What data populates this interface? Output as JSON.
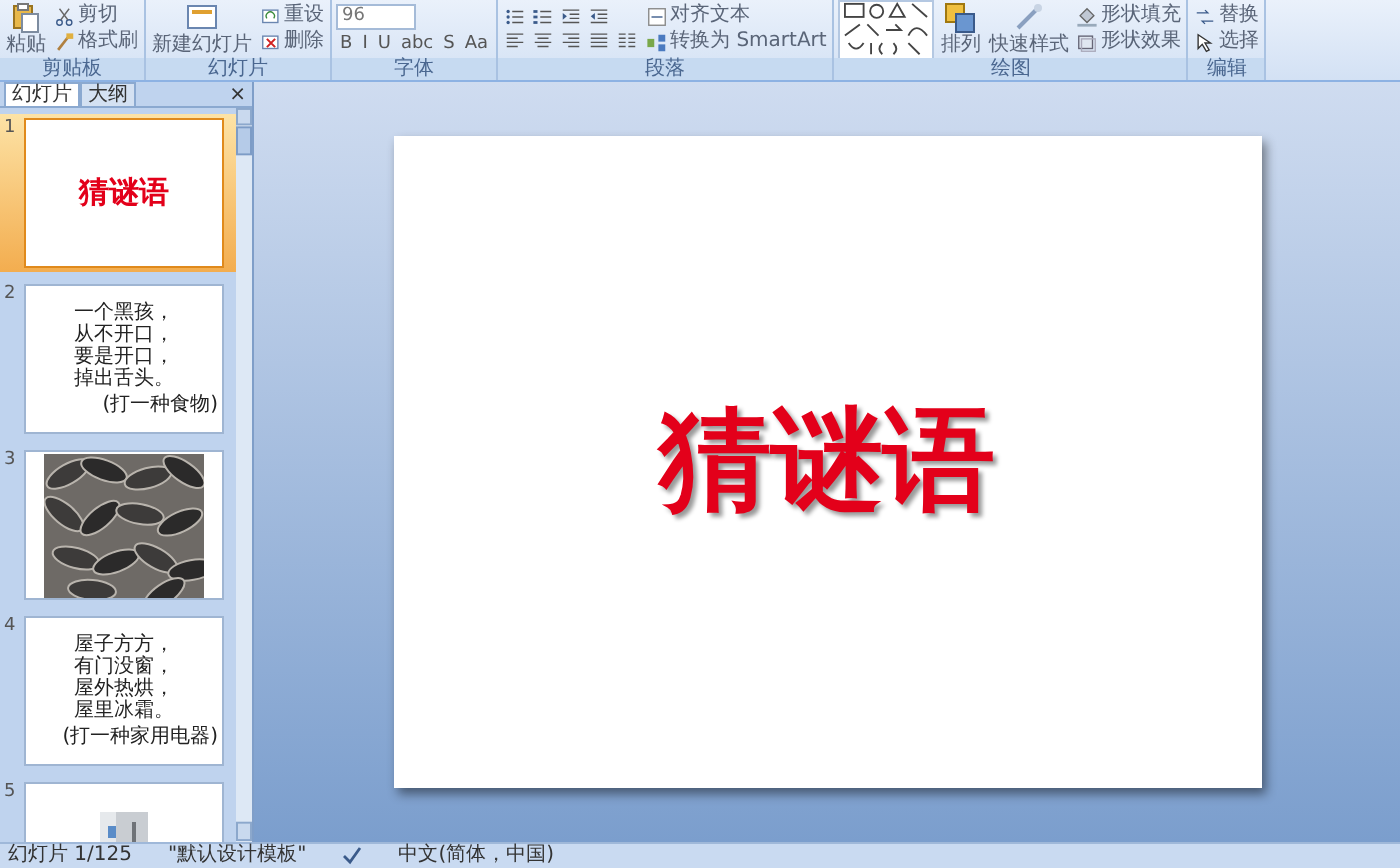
{
  "ribbon": {
    "groups": [
      {
        "label": "剪贴板",
        "columns": [
          [
            {
              "kind": "large",
              "label": "粘贴"
            }
          ],
          [
            {
              "kind": "small",
              "label": "剪切"
            },
            {
              "kind": "small",
              "label": "格式刷"
            }
          ]
        ]
      },
      {
        "label": "幻灯片",
        "columns": [
          [
            {
              "kind": "large",
              "label": "新建幻灯片"
            }
          ],
          [
            {
              "kind": "small",
              "label": "重设"
            },
            {
              "kind": "small",
              "label": "删除"
            }
          ]
        ]
      },
      {
        "label": "字体",
        "columns": [
          [
            {
              "kind": "field",
              "value": "96"
            },
            {
              "kind": "row",
              "items": [
                {
                  "kind": "glyph",
                  "label": "B"
                },
                {
                  "kind": "glyph",
                  "label": "I"
                },
                {
                  "kind": "glyph",
                  "label": "U"
                },
                {
                  "kind": "glyph",
                  "label": "abc"
                },
                {
                  "kind": "glyph",
                  "label": "S"
                },
                {
                  "kind": "glyph",
                  "label": "Aa"
                }
              ]
            }
          ]
        ]
      },
      {
        "label": "段落",
        "columns": [
          [
            {
              "kind": "row",
              "items": [
                {
                  "kind": "icon"
                },
                {
                  "kind": "icon"
                },
                {
                  "kind": "icon"
                },
                {
                  "kind": "icon"
                }
              ]
            },
            {
              "kind": "row",
              "items": [
                {
                  "kind": "icon"
                },
                {
                  "kind": "icon"
                },
                {
                  "kind": "icon"
                },
                {
                  "kind": "icon"
                },
                {
                  "kind": "icon"
                }
              ]
            }
          ],
          [
            {
              "kind": "small",
              "label": "对齐文本"
            },
            {
              "kind": "small",
              "label": "转换为 SmartArt"
            }
          ]
        ]
      },
      {
        "label": "绘图",
        "columns": [
          [
            {
              "kind": "gallery"
            }
          ],
          [
            {
              "kind": "large",
              "label": "排列"
            }
          ],
          [
            {
              "kind": "large",
              "label": "快速样式"
            }
          ],
          [
            {
              "kind": "small",
              "label": "形状填充"
            },
            {
              "kind": "small",
              "label": "形状效果"
            }
          ]
        ]
      },
      {
        "label": "编辑",
        "columns": [
          [
            {
              "kind": "small",
              "label": "替换"
            },
            {
              "kind": "small",
              "label": "选择"
            }
          ]
        ]
      }
    ]
  },
  "panel": {
    "tabs": [
      {
        "label": "幻灯片",
        "selected": true
      },
      {
        "label": "大纲",
        "selected": false
      }
    ],
    "close": "×"
  },
  "slides": [
    {
      "number": "1",
      "selected": true,
      "kind": "title",
      "title": "猜谜语"
    },
    {
      "number": "2",
      "selected": false,
      "kind": "riddle",
      "lines": [
        "一个黑孩，",
        "从不开口，",
        "要是开口，",
        "掉出舌头。"
      ],
      "hint": "(打一种食物)"
    },
    {
      "number": "3",
      "selected": false,
      "kind": "picture"
    },
    {
      "number": "4",
      "selected": false,
      "kind": "riddle",
      "lines": [
        "屋子方方，",
        "有门没窗，",
        "屋外热烘，",
        "屋里冰霜。"
      ],
      "hint": "(打一种家用电器)"
    },
    {
      "number": "5",
      "selected": false,
      "kind": "picture"
    }
  ],
  "editor": {
    "title": "猜谜语"
  },
  "status_bar": {
    "slide": "幻灯片 1/125",
    "theme": "\"默认设计模板\"",
    "language": "中文(简体，中国)"
  }
}
